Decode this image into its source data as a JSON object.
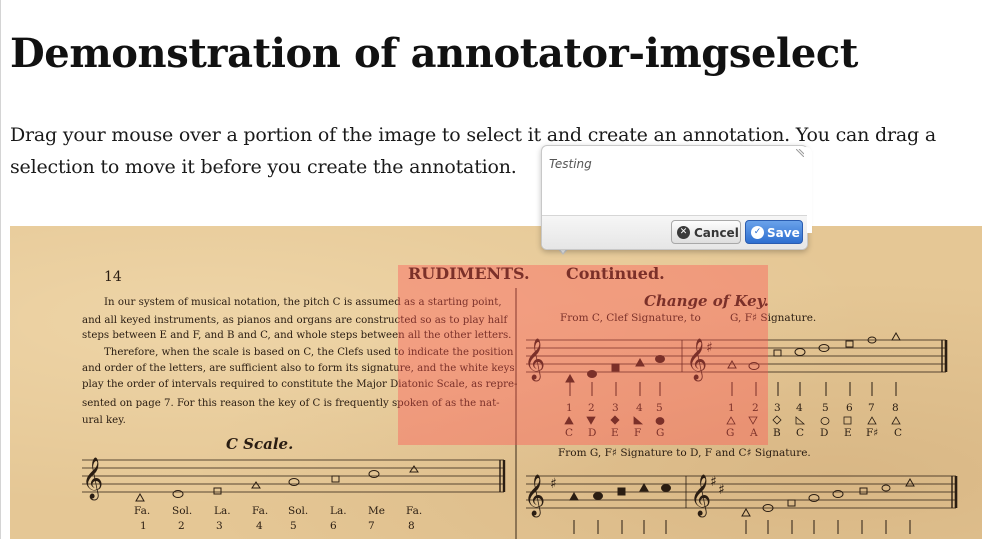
{
  "page": {
    "title": "Demonstration of annotator-imgselect",
    "intro": "Drag your mouse over a portion of the image to select it and create an annotation. You can drag a selection to move it before you create the annotation."
  },
  "image": {
    "page_number": "14",
    "heading_rudiments": "RUDIMENTS.",
    "heading_continued": "Continued.",
    "paragraph_lines": [
      "In our system of musical notation, the pitch C is assumed as a starting point,",
      "and all keyed instruments, as pianos and organs are constructed so as to play half",
      "steps between E and F, and B and C, and whole steps between all the other letters.",
      "Therefore, when the scale is based on C, the Clefs used to indicate the position",
      "and order of the letters, are sufficient also to form its signature, and the white keys",
      "play the order of intervals required to constitute the Major Diatonic Scale, as repre-",
      "sented on page 7. For this reason the key of C is frequently spoken of as the nat-",
      "ural key."
    ],
    "c_scale_title": "C Scale.",
    "change_of_key_title": "Change of Key.",
    "from_c_caption": "From C, Clef Signature, to",
    "to_g_caption": "G, F♯ Signature.",
    "from_g_caption": "From G, F♯ Signature to D, F and C♯ Signature.",
    "scale_numbers_1": [
      "1",
      "2",
      "3",
      "4",
      "5"
    ],
    "scale_numbers_2": [
      "1",
      "2",
      "3",
      "4",
      "5",
      "6",
      "7",
      "8"
    ],
    "note_letters_1": [
      "C",
      "D",
      "E",
      "F",
      "G"
    ],
    "note_letters_2": [
      "G",
      "A",
      "B",
      "C",
      "D",
      "E",
      "F♯",
      "C"
    ],
    "syllables": [
      "Fa.",
      "Sol.",
      "La.",
      "Fa.",
      "Sol.",
      "La.",
      "Me",
      "Fa."
    ],
    "syllable_numbers": [
      "1",
      "2",
      "3",
      "4",
      "5",
      "6",
      "7",
      "8"
    ]
  },
  "editor": {
    "text_value": "Testing",
    "cancel_label": "Cancel",
    "save_label": "Save",
    "cancel_icon": "close-circle-icon",
    "save_icon": "check-circle-icon"
  },
  "colors": {
    "selection": "#ff5050",
    "save_button": "#2e6fd0",
    "paper": "#e5c795"
  }
}
